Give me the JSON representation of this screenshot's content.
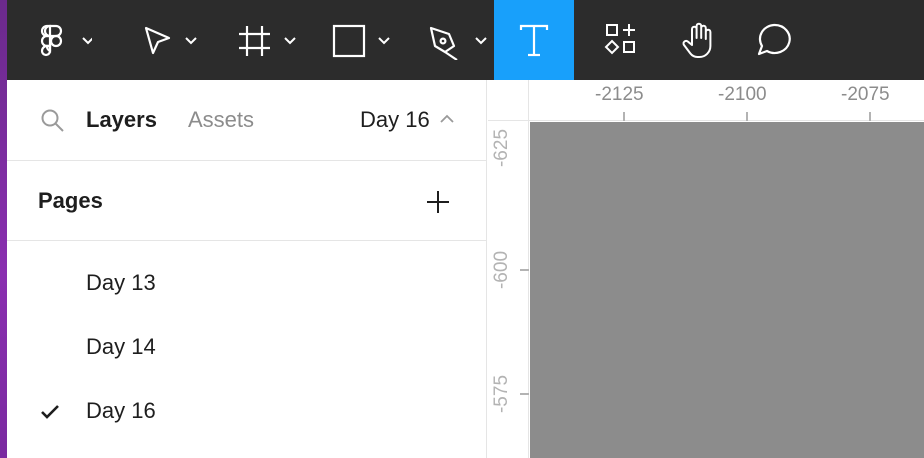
{
  "toolbar": {
    "active_tool": "text",
    "tools": [
      {
        "id": "main-menu",
        "icon": "figma-logo-icon",
        "has_dropdown": true
      },
      {
        "id": "move",
        "icon": "move-cursor-icon",
        "has_dropdown": true
      },
      {
        "id": "frame",
        "icon": "frame-icon",
        "has_dropdown": true
      },
      {
        "id": "shape",
        "icon": "rectangle-icon",
        "has_dropdown": true
      },
      {
        "id": "pen",
        "icon": "pen-icon",
        "has_dropdown": true
      },
      {
        "id": "text",
        "icon": "text-icon",
        "has_dropdown": false
      },
      {
        "id": "resources",
        "icon": "resources-icon",
        "has_dropdown": false
      },
      {
        "id": "hand",
        "icon": "hand-icon",
        "has_dropdown": false
      },
      {
        "id": "comment",
        "icon": "comment-icon",
        "has_dropdown": false
      }
    ],
    "colors": {
      "background": "#2c2c2c",
      "active": "#18a0fb",
      "icon": "#ffffff"
    }
  },
  "left_panel": {
    "tabs": {
      "layers": "Layers",
      "assets": "Assets"
    },
    "current_page": "Day 16",
    "pages_title": "Pages",
    "pages": [
      {
        "label": "Day 13",
        "selected": false
      },
      {
        "label": "Day 14",
        "selected": false
      },
      {
        "label": "Day 16",
        "selected": true
      }
    ]
  },
  "rulers": {
    "x_labels": [
      "-2125",
      "-2100",
      "-2075"
    ],
    "y_labels": [
      "-625",
      "-600",
      "-575"
    ]
  },
  "canvas": {
    "background": "#8c8c8c"
  }
}
